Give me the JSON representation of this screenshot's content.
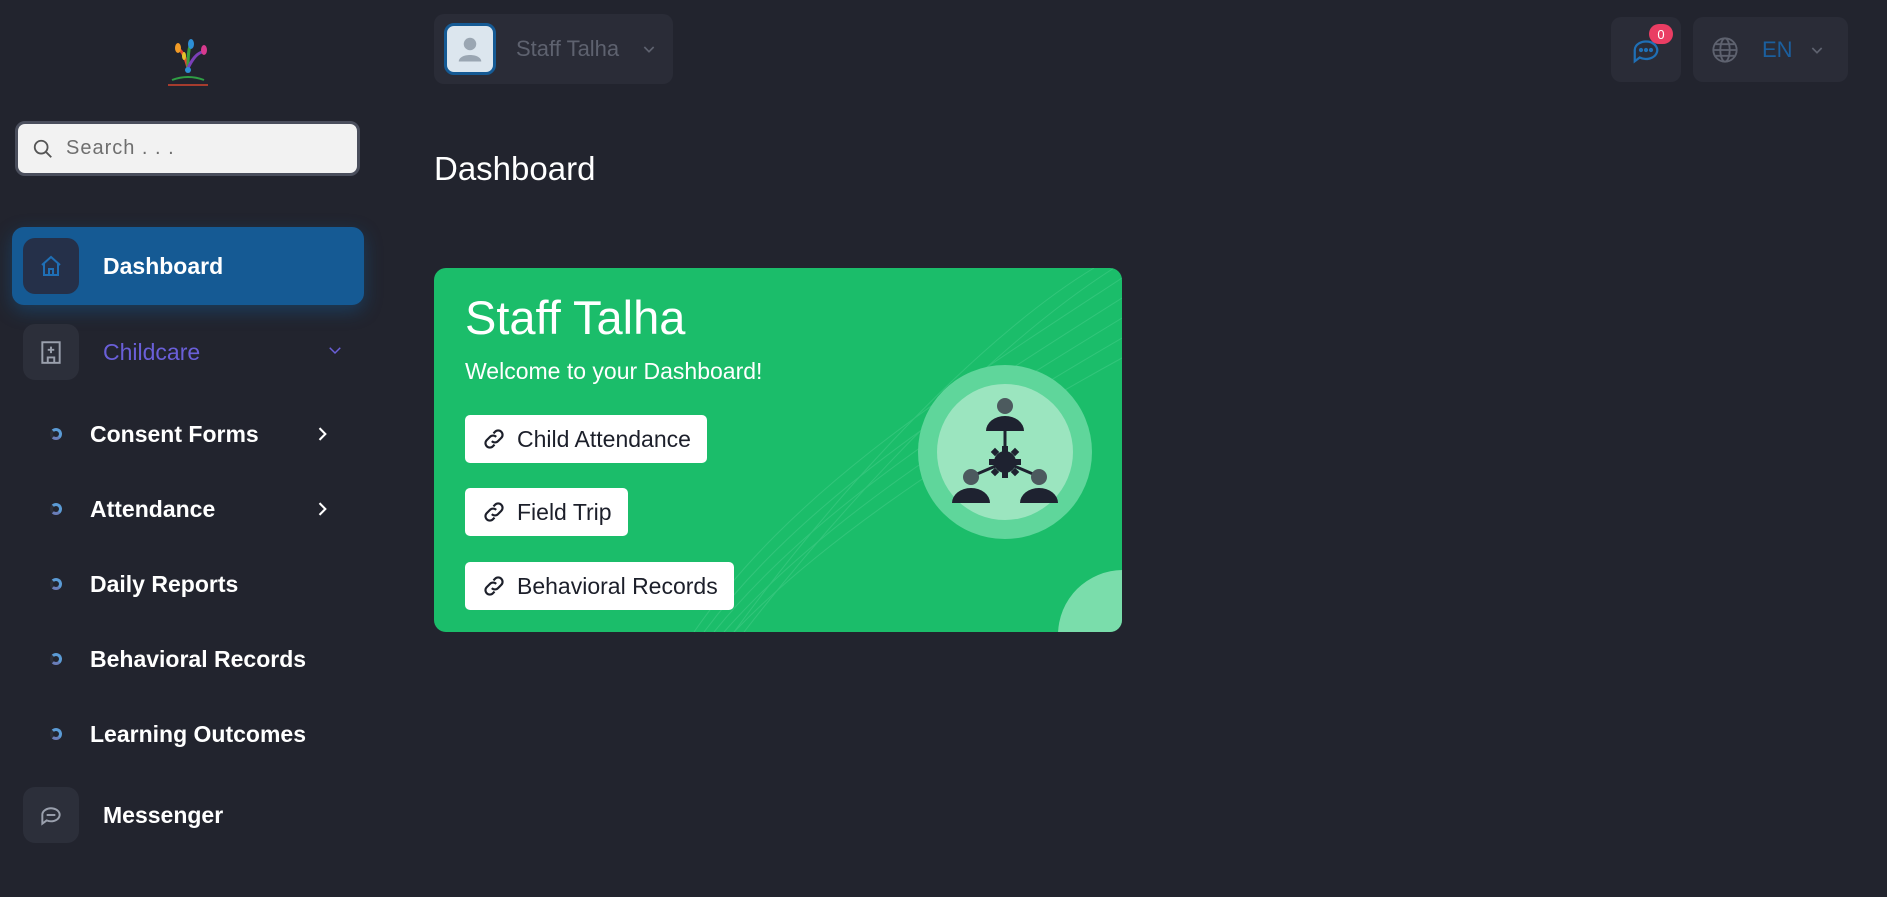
{
  "sidebar": {
    "search_placeholder": "Search . . .",
    "items": [
      {
        "label": "Dashboard",
        "icon": "home-icon",
        "active": true
      },
      {
        "label": "Childcare",
        "icon": "hospital-icon",
        "expanded": true
      },
      {
        "label": "Messenger",
        "icon": "chat-icon"
      }
    ],
    "childcare_sub": [
      {
        "label": "Consent Forms",
        "has_children": true
      },
      {
        "label": "Attendance",
        "has_children": true
      },
      {
        "label": "Daily Reports",
        "has_children": false
      },
      {
        "label": "Behavioral Records",
        "has_children": false
      },
      {
        "label": "Learning Outcomes",
        "has_children": false
      }
    ]
  },
  "header": {
    "user_name": "Staff Talha",
    "messages_count": "0",
    "language": "EN"
  },
  "main": {
    "page_title": "Dashboard",
    "card": {
      "title": "Staff Talha",
      "subtitle": "Welcome to your Dashboard!",
      "links": [
        {
          "label": "Child Attendance"
        },
        {
          "label": "Field Trip"
        },
        {
          "label": "Behavioral Records"
        }
      ]
    }
  },
  "colors": {
    "background": "#22242e",
    "accent": "#155a94",
    "card": "#1bbd6a",
    "badge": "#ea3d63",
    "childcare_label": "#6a5fd8"
  }
}
